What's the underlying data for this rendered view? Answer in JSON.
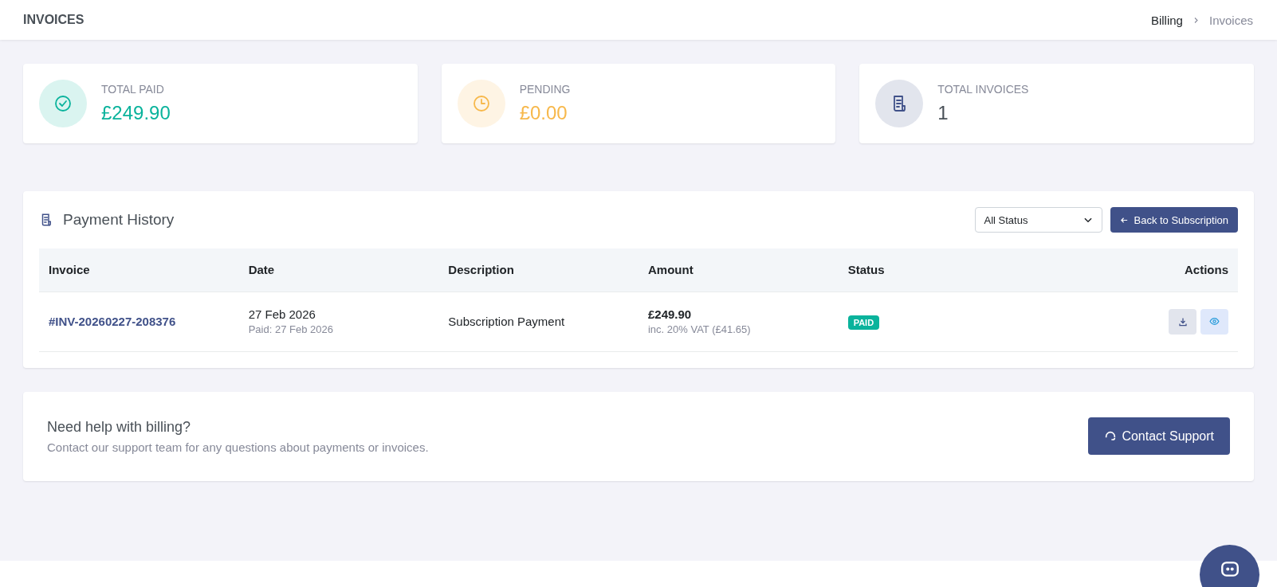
{
  "header": {
    "title": "INVOICES",
    "breadcrumb": [
      {
        "label": "Billing",
        "selected": false
      },
      {
        "label": "Invoices",
        "selected": true
      }
    ]
  },
  "stats": [
    {
      "kind": "paid",
      "label": "TOTAL PAID",
      "value": "£249.90"
    },
    {
      "kind": "pending",
      "label": "PENDING",
      "value": "£0.00"
    },
    {
      "kind": "count",
      "label": "TOTAL INVOICES",
      "value": "1"
    }
  ],
  "history": {
    "title": "Payment History",
    "filter": "All Status",
    "back_button": "Back to Subscription",
    "columns": [
      "Invoice",
      "Date",
      "Description",
      "Amount",
      "Status",
      "Actions"
    ],
    "rows": [
      {
        "invoice": "#INV-20260227-208376",
        "date": "27 Feb 2026",
        "paid_date": "Paid: 27 Feb 2026",
        "description": "Subscription Payment",
        "amount": "£249.90",
        "vat": "inc. 20% VAT (£41.65)",
        "status": "PAID",
        "color": "#0ab39c"
      }
    ]
  },
  "help": {
    "title": "Need help with billing?",
    "text": "Contact our support team for any questions about payments or invoices.",
    "button": "Contact Support"
  }
}
